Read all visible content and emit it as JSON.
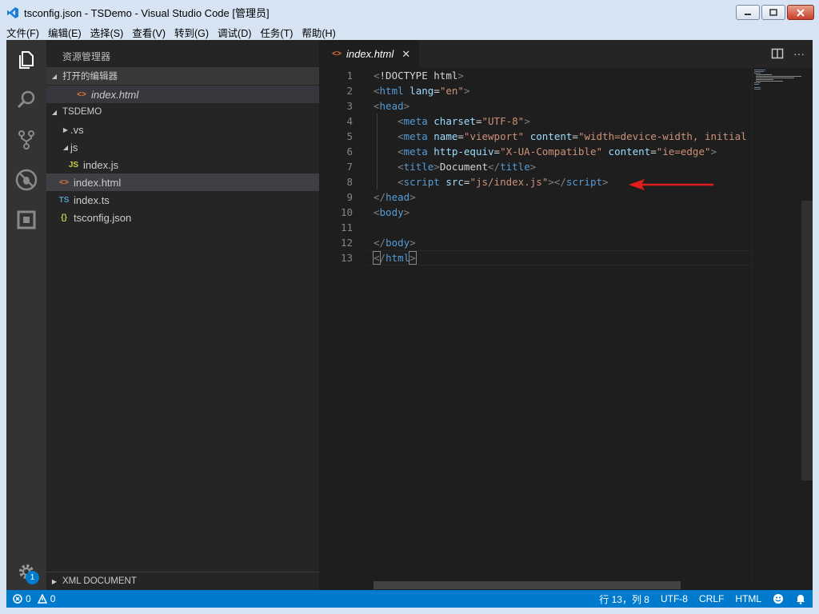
{
  "window": {
    "title": "tsconfig.json - TSDemo - Visual Studio Code [管理员]"
  },
  "menu": [
    "文件(F)",
    "编辑(E)",
    "选择(S)",
    "查看(V)",
    "转到(G)",
    "调试(D)",
    "任务(T)",
    "帮助(H)"
  ],
  "activity": {
    "icons": [
      "files-icon",
      "search-icon",
      "source-control-icon",
      "debug-icon",
      "extensions-icon",
      "settings-gear-icon"
    ],
    "badge": "1"
  },
  "sidebar": {
    "title": "资源管理器",
    "open_editors_label": "打开的编辑器",
    "open_editor_file": "index.html",
    "project_label": "TSDEMO",
    "tree": [
      {
        "label": ".vs",
        "icon": "",
        "type": "folder-collapsed"
      },
      {
        "label": "js",
        "icon": "",
        "type": "folder-expanded"
      },
      {
        "label": "index.js",
        "icon": "JS",
        "type": "file"
      },
      {
        "label": "index.html",
        "icon": "<>",
        "type": "file"
      },
      {
        "label": "index.ts",
        "icon": "TS",
        "type": "file"
      },
      {
        "label": "tsconfig.json",
        "icon": "{}",
        "type": "file"
      }
    ],
    "xml_section": "XML DOCUMENT"
  },
  "editor": {
    "tab_label": "index.html",
    "line_numbers": [
      "1",
      "2",
      "3",
      "4",
      "5",
      "6",
      "7",
      "8",
      "9",
      "10",
      "11",
      "12",
      "13"
    ]
  },
  "status": {
    "errors": "0",
    "warnings": "0",
    "position": "行 13，列 8",
    "encoding": "UTF-8",
    "eol": "CRLF",
    "language": "HTML"
  },
  "colors": {
    "accent": "#007acc",
    "sidebar_bg": "#252526",
    "editor_bg": "#1e1e1e",
    "activity_bg": "#333333",
    "arrow": "#e51c1c"
  }
}
